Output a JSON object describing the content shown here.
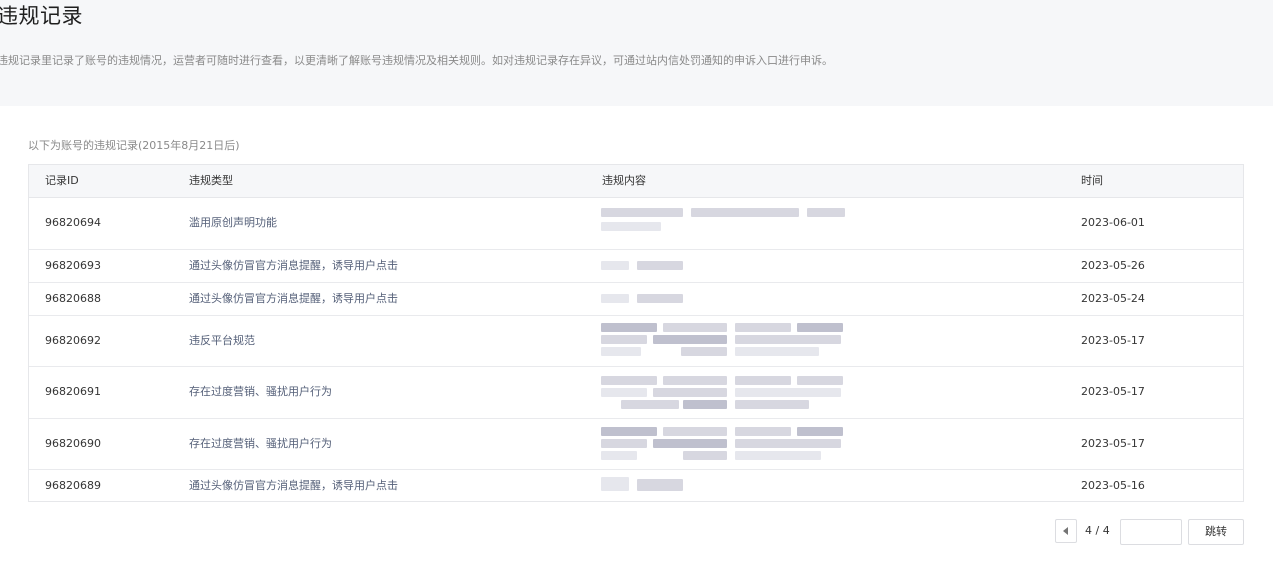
{
  "header": {
    "title": "违规记录",
    "description": "违规记录里记录了账号的违规情况，运营者可随时进行查看，以更清晰了解账号违规情况及相关规则。如对违规记录存在异议，可通过站内信处罚通知的申诉入口进行申诉。"
  },
  "table": {
    "caption": "以下为账号的违规记录(2015年8月21日后)",
    "columns": {
      "id": "记录ID",
      "type": "违规类型",
      "content": "违规内容",
      "time": "时间"
    },
    "rows": [
      {
        "id": "96820694",
        "type": "滥用原创声明功能",
        "time": "2023-06-01"
      },
      {
        "id": "96820693",
        "type": "通过头像仿冒官方消息提醒，诱导用户点击",
        "time": "2023-05-26"
      },
      {
        "id": "96820688",
        "type": "通过头像仿冒官方消息提醒，诱导用户点击",
        "time": "2023-05-24"
      },
      {
        "id": "96820692",
        "type": "违反平台规范",
        "time": "2023-05-17"
      },
      {
        "id": "96820691",
        "type": "存在过度营销、骚扰用户行为",
        "time": "2023-05-17"
      },
      {
        "id": "96820690",
        "type": "存在过度营销、骚扰用户行为",
        "time": "2023-05-17"
      },
      {
        "id": "96820689",
        "type": "通过头像仿冒官方消息提醒，诱导用户点击",
        "time": "2023-05-16"
      }
    ]
  },
  "pagination": {
    "page_info": "4 / 4",
    "jump_input_value": "",
    "jump_label": "跳转"
  }
}
